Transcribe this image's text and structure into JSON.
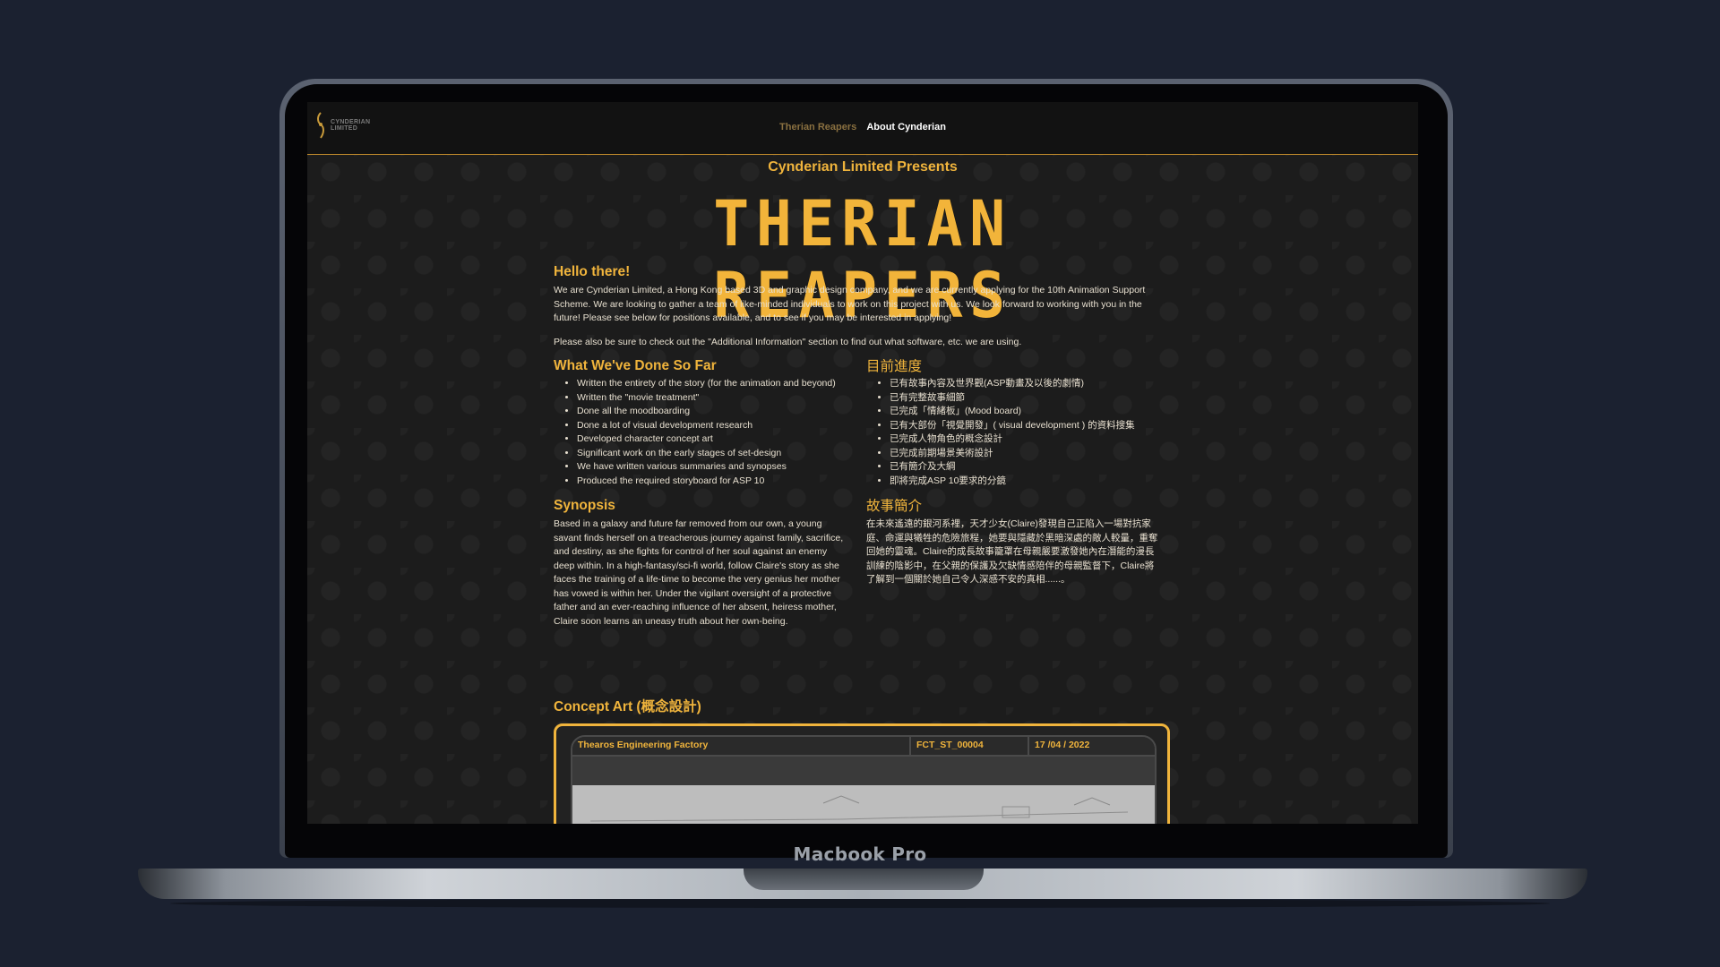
{
  "device": {
    "model_label": "Macbook Pro"
  },
  "nav": {
    "logo_text_line1": "CYNDERIAN",
    "logo_text_line2": "LIMITED",
    "links": [
      {
        "label": "Therian Reapers",
        "active": false
      },
      {
        "label": "About Cynderian",
        "active": true
      }
    ]
  },
  "hero": {
    "presents": "Cynderian Limited Presents",
    "title_line1": "THERIAN",
    "title_line2": "REAPERS"
  },
  "intro": {
    "heading": "Hello there!",
    "paragraph1": "We are Cynderian Limited, a Hong Kong based 3D and graphic design company, and we are currently applying for the 10th Animation Support Scheme. We are looking to gather a team of like-minded individuals to work on this project with us. We look forward to working with you in the future! Please see below for positions available, and to see if you may be interested in applying!",
    "paragraph2": "Please also be sure to check out the \"Additional Information\" section to find out what software, etc. we are using."
  },
  "progress": {
    "heading_en": "What We've Done So Far",
    "items_en": [
      "Written the entirety of the story (for the animation and beyond)",
      "Written the \"movie treatment\"",
      "Done all the moodboarding",
      "Done a lot of visual development research",
      "Developed character concept art",
      "Significant work on the early stages of set-design",
      "We have written various summaries and synopses",
      "Produced the required storyboard for ASP 10"
    ],
    "heading_zh": "目前進度",
    "items_zh": [
      "已有故事內容及世界觀(ASP動畫及以後的劇情)",
      "已有完整故事細節",
      "已完成「情緒板」(Mood board)",
      "已有大部份「視覺開發」( visual development ) 的資料搜集",
      "已完成人物角色的概念設計",
      "已完成前期場景美術設計",
      "已有簡介及大綱",
      "即將完成ASP 10要求的分鏡"
    ]
  },
  "synopsis": {
    "heading_en": "Synopsis",
    "text_en": "Based in a galaxy and future far removed from our own, a young savant finds herself on a treacherous journey against family, sacrifice, and destiny, as she fights for control of her soul against an enemy deep within. In a high-fantasy/sci-fi world, follow Claire's story as she faces the training of a life-time to become the very genius her mother has vowed is within her. Under the vigilant oversight of a protective father and an ever-reaching influence of her absent, heiress mother, Claire soon learns an uneasy truth about her own-being.",
    "heading_zh": "故事簡介",
    "text_zh": "在未來遙遠的銀河系裡，天才少女(Claire)發現自己正陷入一場對抗家庭、命運與犧牲的危險旅程，她要與隱藏於黑暗深處的敵人較量，重奪回她的靈魂。Claire的成長故事籠罩在母親嚴要激發她內在潛能的漫長訓練的陰影中，在父親的保護及欠缺情感陪伴的母親監督下，Claire將了解到一個關於她自己令人深感不安的真相......。"
  },
  "concept": {
    "heading": "Concept Art (概念設計)",
    "sheet_title": "Thearos Engineering Factory",
    "sheet_code": "FCT_ST_00004",
    "sheet_date": "17 /04 / 2022"
  }
}
